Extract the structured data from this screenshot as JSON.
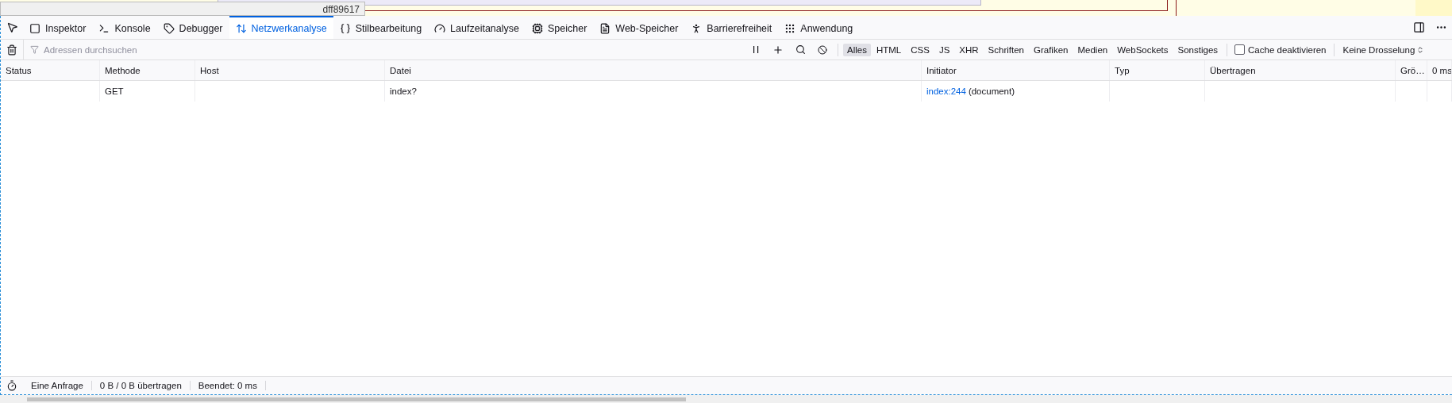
{
  "page": {
    "tooltip": "dff89617"
  },
  "tabs": [
    {
      "label": "Inspektor",
      "selected": false
    },
    {
      "label": "Konsole",
      "selected": false
    },
    {
      "label": "Debugger",
      "selected": false
    },
    {
      "label": "Netzwerkanalyse",
      "selected": true
    },
    {
      "label": "Stilbearbeitung",
      "selected": false
    },
    {
      "label": "Laufzeitanalyse",
      "selected": false
    },
    {
      "label": "Speicher",
      "selected": false
    },
    {
      "label": "Web-Speicher",
      "selected": false
    },
    {
      "label": "Barrierefreiheit",
      "selected": false
    },
    {
      "label": "Anwendung",
      "selected": false
    }
  ],
  "toolbar": {
    "search": {
      "placeholder": "Adressen durchsuchen"
    },
    "filters": [
      {
        "label": "Alles",
        "selected": true
      },
      {
        "label": "HTML",
        "selected": false
      },
      {
        "label": "CSS",
        "selected": false
      },
      {
        "label": "JS",
        "selected": false
      },
      {
        "label": "XHR",
        "selected": false
      },
      {
        "label": "Schriften",
        "selected": false
      },
      {
        "label": "Grafiken",
        "selected": false
      },
      {
        "label": "Medien",
        "selected": false
      },
      {
        "label": "WebSockets",
        "selected": false
      },
      {
        "label": "Sonstiges",
        "selected": false
      }
    ],
    "cache": {
      "label": "Cache deaktivieren",
      "checked": false
    },
    "throttling": "Keine Drosselung"
  },
  "table": {
    "columns": [
      "Status",
      "Methode",
      "Host",
      "Datei",
      "Initiator",
      "Typ",
      "Übertragen",
      "Grö…",
      "0 ms"
    ],
    "rows": [
      {
        "status": "",
        "method": "GET",
        "host": "",
        "file": "index?",
        "initiator_link": "index:244",
        "initiator_type": "(document)",
        "type": "",
        "transferred": "",
        "size": ""
      }
    ]
  },
  "status_bar": [
    "Eine Anfrage",
    "0 B / 0 B übertragen",
    "Beendet: 0 ms"
  ]
}
